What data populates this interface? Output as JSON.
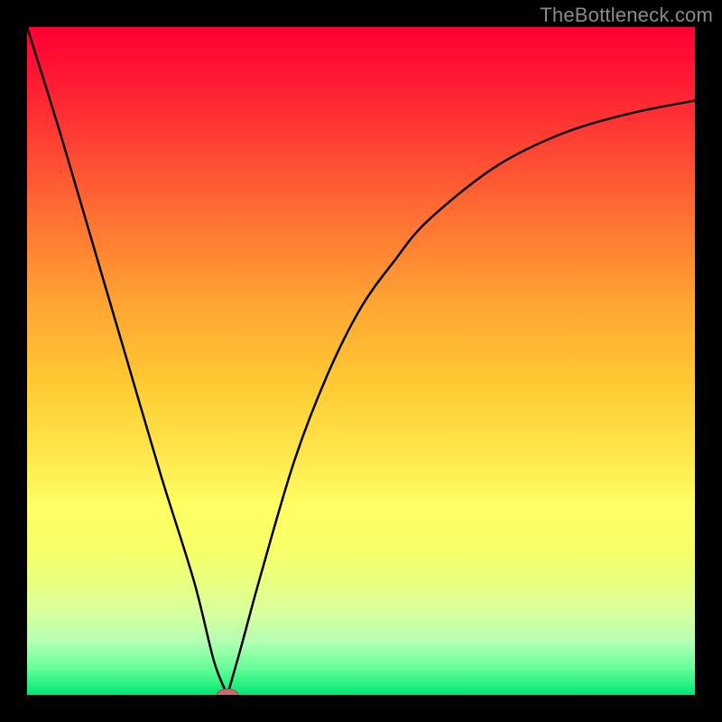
{
  "watermark": {
    "text": "TheBottleneck.com"
  },
  "colors": {
    "page_bg": "#000000",
    "curve_stroke": "#000000",
    "marker_fill": "#c76b6b",
    "marker_stroke": "#a34040",
    "gradient_stops": [
      "#ff0033",
      "#ff7733",
      "#ffcc33",
      "#ffff66",
      "#00e673"
    ]
  },
  "chart_data": {
    "type": "line",
    "title": "",
    "xlabel": "",
    "ylabel": "",
    "xlim": [
      0,
      100
    ],
    "ylim": [
      0,
      100
    ],
    "grid": false,
    "legend": false,
    "axes_visible": false,
    "series": [
      {
        "name": "left-branch",
        "x": [
          0,
          5,
          10,
          15,
          20,
          25,
          28,
          30
        ],
        "y": [
          100,
          84,
          67,
          50,
          33,
          17,
          5,
          0
        ]
      },
      {
        "name": "right-branch",
        "x": [
          30,
          32,
          35,
          40,
          45,
          50,
          55,
          60,
          70,
          80,
          90,
          100
        ],
        "y": [
          0,
          7,
          18,
          35,
          48,
          58,
          65,
          71,
          79,
          84,
          87,
          89
        ]
      }
    ],
    "marker": {
      "x": 30,
      "y": 0,
      "shape": "ellipse",
      "rx": 1.6,
      "ry": 0.9
    }
  }
}
